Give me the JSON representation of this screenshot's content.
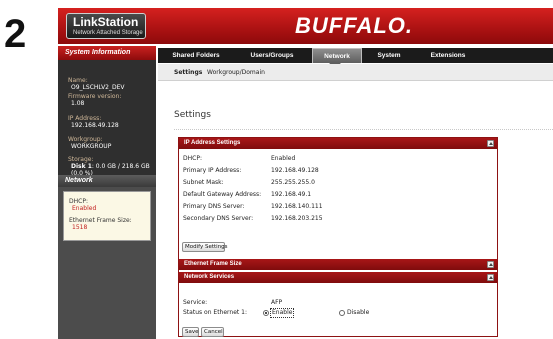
{
  "step_number": "2",
  "header": {
    "logo_title": "LinkStation",
    "logo_subtitle": "Network Attached Storage",
    "brand": "BUFFALO."
  },
  "nav": {
    "tabs": [
      {
        "label": "Shared Folders",
        "active": false
      },
      {
        "label": "Users/Groups",
        "active": false
      },
      {
        "label": "Network",
        "active": true
      },
      {
        "label": "System",
        "active": false
      },
      {
        "label": "Extensions",
        "active": false
      }
    ]
  },
  "subtabs": [
    {
      "label": "Settings",
      "active": true
    },
    {
      "label": "Workgroup/Domain",
      "active": false
    }
  ],
  "sidebar": {
    "header": "System Information",
    "name_label": "Name:",
    "name_value": "O9_LSCHLV2_DEV",
    "firmware_label": "Firmware version:",
    "firmware_value": "1.08",
    "ip_label": "IP Address:",
    "ip_value": "192.168.49.128",
    "workgroup_label": "Workgroup:",
    "workgroup_value": "WORKGROUP",
    "storage_label": "Storage:",
    "storage_disk": "Disk 1",
    "storage_value": ": 0.0 GB / 218.6 GB",
    "storage_percent": "(0.0 %)",
    "network_header": "Network",
    "dhcp_label": "DHCP:",
    "dhcp_value": "Enabled",
    "frame_label": "Ethernet Frame Size:",
    "frame_value": "1518"
  },
  "page_title": "Settings",
  "ip_section": {
    "title": "IP Address Settings",
    "rows": [
      {
        "label": "DHCP:",
        "value": "Enabled"
      },
      {
        "label": "Primary IP Address:",
        "value": "192.168.49.128"
      },
      {
        "label": "Subnet Mask:",
        "value": "255.255.255.0"
      },
      {
        "label": "Default Gateway Address:",
        "value": "192.168.49.1"
      },
      {
        "label": "Primary DNS Server:",
        "value": "192.168.140.111"
      },
      {
        "label": "Secondary DNS Server:",
        "value": "192.168.203.215"
      }
    ],
    "modify_button": "Modify Settings"
  },
  "frame_section": {
    "title": "Ethernet Frame Size"
  },
  "services_section": {
    "title": "Network Services",
    "service_label": "Service:",
    "service_value": "AFP",
    "status_label": "Status on Ethernet 1:",
    "enable_label": "Enable",
    "disable_label": "Disable",
    "selected": "Enable",
    "save_button": "Save",
    "cancel_button": "Cancel"
  },
  "colors": {
    "accent_red": "#a81617",
    "sidebar_dark": "#2f2f2f",
    "status_red": "#c21e1e"
  }
}
